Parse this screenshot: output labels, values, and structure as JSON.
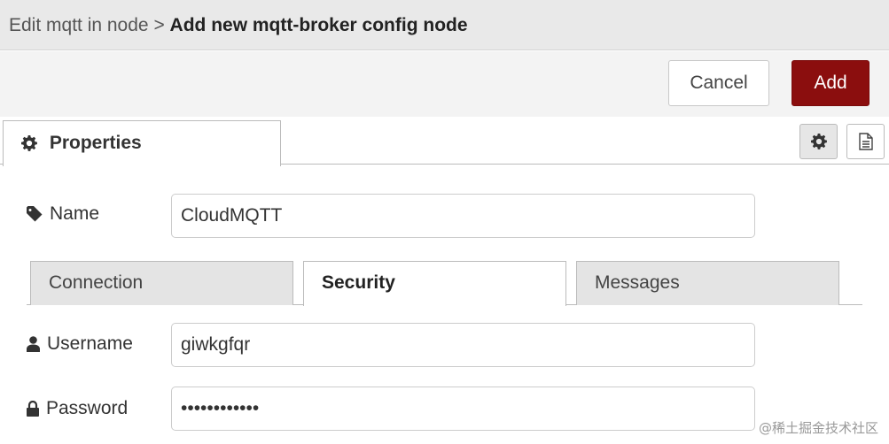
{
  "header": {
    "breadcrumb_parent": "Edit mqtt in node",
    "separator": ">",
    "title": "Add new mqtt-broker config node"
  },
  "toolbar": {
    "cancel_label": "Cancel",
    "add_label": "Add",
    "add_color": "#8b0e0e"
  },
  "tabs": {
    "properties_label": "Properties",
    "properties_icon": "gear-icon",
    "settings_icon": "gear-icon",
    "description_icon": "file-text-icon"
  },
  "form": {
    "name": {
      "label": "Name",
      "icon": "tag-icon",
      "value": "CloudMQTT"
    },
    "subtabs": [
      "Connection",
      "Security",
      "Messages"
    ],
    "active_subtab": "Security",
    "username": {
      "label": "Username",
      "icon": "user-icon",
      "value": "giwkgfqr"
    },
    "password": {
      "label": "Password",
      "icon": "lock-icon",
      "value": "••••••••••••"
    }
  },
  "watermark": "@稀土掘金技术社区"
}
